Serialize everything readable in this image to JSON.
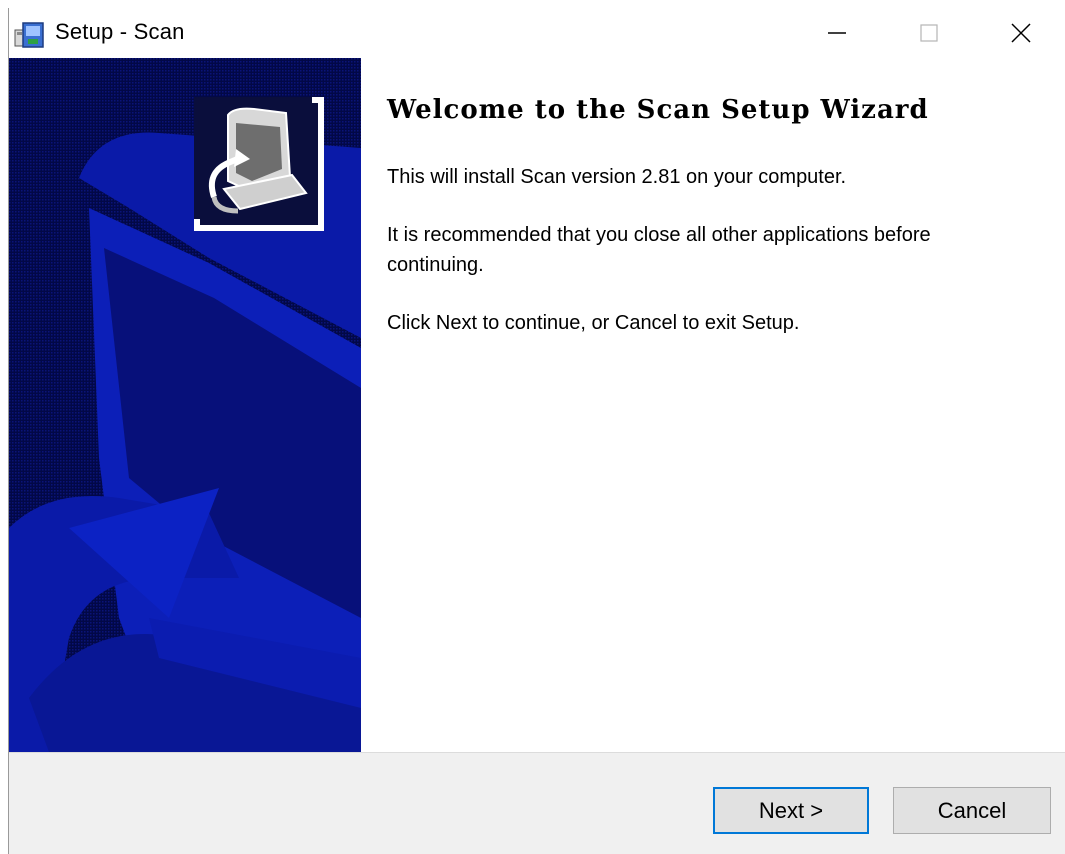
{
  "window": {
    "title": "Setup - Scan",
    "controls": {
      "minimize": "minimize-icon",
      "maximize": "maximize-icon",
      "close": "close-icon"
    }
  },
  "banner": {
    "logo_icon": "computer-install-icon",
    "background_color": "#020847",
    "art_color": "#0a1aa8"
  },
  "content": {
    "heading": "Welcome to the Scan Setup Wizard",
    "paragraph_1": "This will install Scan version 2.81 on your computer.",
    "paragraph_2": "It is recommended that you close all other applications before continuing.",
    "paragraph_3": "Click Next to continue, or Cancel to exit Setup."
  },
  "buttons": {
    "next_label": "Next >",
    "cancel_label": "Cancel"
  },
  "colors": {
    "focus_border": "#0078d7",
    "button_face": "#e1e1e1",
    "footer_bg": "#f0f0f0"
  }
}
